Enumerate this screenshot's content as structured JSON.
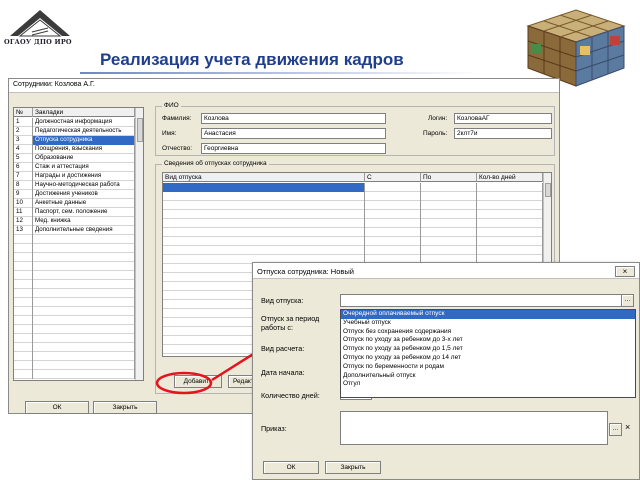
{
  "slide": {
    "logo_text": "ОГАОУ ДПО ИРО",
    "title": "Реализация учета движения кадров"
  },
  "main_window": {
    "title": "Сотрудники: Козлова А.Г.",
    "bookmarks": {
      "col_num": "№",
      "col_name": "Закладки",
      "rows": [
        {
          "num": "1",
          "name": "Должностная информация"
        },
        {
          "num": "2",
          "name": "Педагогическая деятельность"
        },
        {
          "num": "3",
          "name": "Отпуска сотрудника"
        },
        {
          "num": "4",
          "name": "Поощрения, взыскания"
        },
        {
          "num": "5",
          "name": "Образование"
        },
        {
          "num": "6",
          "name": "Стаж и аттестация"
        },
        {
          "num": "7",
          "name": "Награды и достижения"
        },
        {
          "num": "8",
          "name": "Научно-методическая работа"
        },
        {
          "num": "9",
          "name": "Достижения учеников"
        },
        {
          "num": "10",
          "name": "Анкетные данные"
        },
        {
          "num": "11",
          "name": "Паспорт, сем. положение"
        },
        {
          "num": "12",
          "name": "Мед. книжка"
        },
        {
          "num": "13",
          "name": "Дополнительные сведения"
        }
      ],
      "selected_index": 2
    },
    "fio": {
      "group_label": "ФИО",
      "surname_label": "Фамилия:",
      "surname_value": "Козлова",
      "name_label": "Имя:",
      "name_value": "Анастасия",
      "patronymic_label": "Отчество:",
      "patronymic_value": "Георгиевна",
      "login_label": "Логин:",
      "login_value": "КозловаАГ",
      "password_label": "Пароль:",
      "password_value": "2клт7и"
    },
    "vacations": {
      "group_label": "Сведения об отпусках сотрудника",
      "col_type": "Вид отпуска",
      "col_from": "С",
      "col_to": "По",
      "col_days": "Кол-во дней"
    },
    "add_button": "Добавить",
    "edit_button": "Редакт",
    "ok_button": "ОК",
    "close_button": "Закрыть"
  },
  "dialog": {
    "title": "Отпуска сотрудника: Новый",
    "vacation_type_label": "Вид отпуска:",
    "vacation_type_value": "",
    "work_period_label": "Отпуск за период работы с:",
    "calc_type_label": "Вид расчета:",
    "start_date_label": "Дата начала:",
    "days_count_label": "Количество дней:",
    "days_count_value": "0",
    "order_label": "Приказ:",
    "ok_button": "ОК",
    "close_button": "Закрыть",
    "dropdown_options": [
      "Очередной оплачиваемый отпуск",
      "Учебный отпуск",
      "Отпуск без сохранения содержания",
      "Отпуск по уходу за ребенком до 3-х лет",
      "Отпуск по уходу за ребенком до 1,5 лет",
      "Отпуск по уходу за ребенком до 14 лет",
      "Отпуск по беременности и родам",
      "Дополнительный отпуск",
      "Отгул"
    ],
    "dropdown_selected_index": 0
  },
  "colors": {
    "title_blue": "#1f3f8e",
    "selection": "#316ac5",
    "arrow_red": "#e3141b",
    "window_bg": "#ece9d8"
  }
}
